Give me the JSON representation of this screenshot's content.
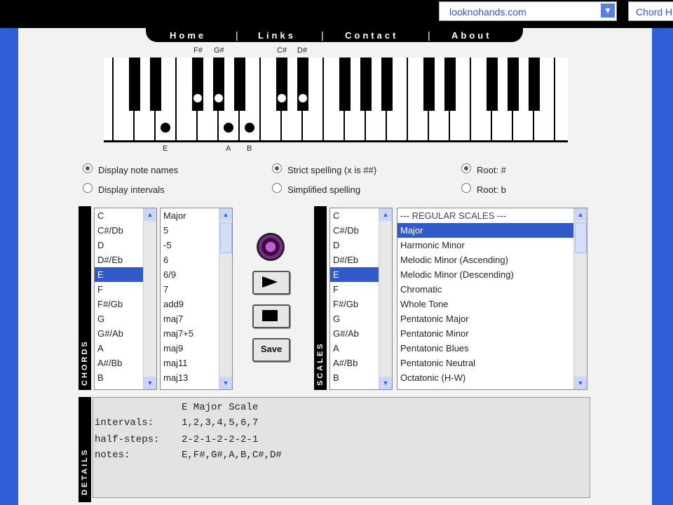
{
  "browser": {
    "url_text": "looknohands.com",
    "url_text2": "Chord H"
  },
  "nav": {
    "items": [
      "Home",
      "Links",
      "Contact",
      "About"
    ],
    "sep": "|"
  },
  "piano": {
    "top_labels": [
      "F#",
      "G#",
      "C#",
      "D#"
    ],
    "bottom_labels": [
      "E",
      "A",
      "B"
    ]
  },
  "options": {
    "display_note_names": "Display note names",
    "display_intervals": "Display intervals",
    "strict_spelling": "Strict spelling (x is ##)",
    "simplified_spelling": "Simplified spelling",
    "root_sharp": "Root: #",
    "root_flat": "Root: b"
  },
  "chords": {
    "label": "CHORDS",
    "roots": [
      "C",
      "C#/Db",
      "D",
      "D#/Eb",
      "E",
      "F",
      "F#/Gb",
      "G",
      "G#/Ab",
      "A",
      "A#/Bb",
      "B"
    ],
    "root_selected": 4,
    "types": [
      "Major",
      "5",
      "-5",
      "6",
      "6/9",
      "7",
      "add9",
      "maj7",
      "maj7+5",
      "maj9",
      "maj11",
      "maj13"
    ]
  },
  "controls": {
    "save_label": "Save"
  },
  "scales": {
    "label": "SCALES",
    "roots": [
      "C",
      "C#/Db",
      "D",
      "D#/Eb",
      "E",
      "F",
      "F#/Gb",
      "G",
      "G#/Ab",
      "A",
      "A#/Bb",
      "B"
    ],
    "root_selected": 4,
    "types": [
      "--- REGULAR SCALES ---",
      "Major",
      "Harmonic Minor",
      "Melodic Minor (Ascending)",
      "Melodic Minor (Descending)",
      "Chromatic",
      "Whole Tone",
      "Pentatonic Major",
      "Pentatonic Minor",
      "Pentatonic Blues",
      "Pentatonic Neutral",
      "Octatonic (H-W)"
    ],
    "type_selected": 1
  },
  "details": {
    "label": "DETAILS",
    "title": "E Major Scale",
    "intervals_label": "intervals:",
    "intervals_value": "1,2,3,4,5,6,7",
    "halfsteps_label": "half-steps:",
    "halfsteps_value": "2-2-1-2-2-2-1",
    "notes_label": "notes:",
    "notes_value": "E,F#,G#,A,B,C#,D#"
  },
  "colors": {
    "background_blue": "#2f5fd8",
    "selection_blue": "#3159c9"
  }
}
